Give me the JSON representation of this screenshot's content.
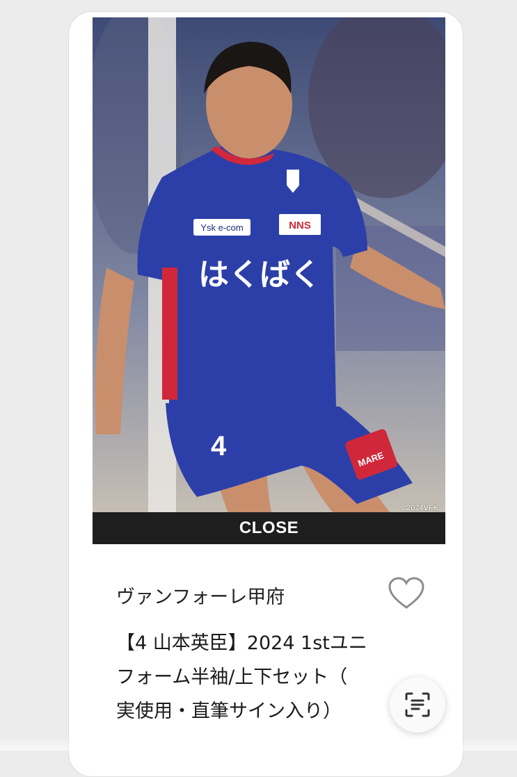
{
  "photo": {
    "alt": "Player wearing No. 4 blue and red kit",
    "copyright": "©2024VFK",
    "shirt_sponsor": "はくばく",
    "sleeve_sponsor": "Ysk e-com",
    "chest_sponsor": "NNS",
    "shorts_number": "4",
    "shorts_sponsor": "MARE",
    "kit_brand_color": "#2c3fa8",
    "kit_accent_color": "#d0283a"
  },
  "close_label": "CLOSE",
  "product": {
    "club": "ヴァンフォーレ甲府",
    "title_lines": [
      "【4 山本英臣】2024 1stユニ",
      "フォーム半袖/上下セット（",
      "実使用・直筆サイン入り）"
    ]
  },
  "icons": {
    "favorite": "heart-outline-icon",
    "scan": "scan-text-icon"
  }
}
